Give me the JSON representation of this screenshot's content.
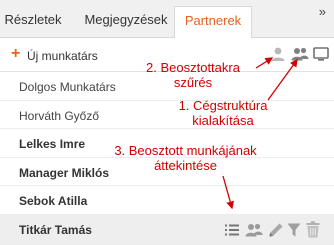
{
  "tabs": [
    {
      "label": "Részletek"
    },
    {
      "label": "Megjegyzések"
    },
    {
      "label": "Partnerek"
    }
  ],
  "more_tabs_glyph": "»",
  "toolbar": {
    "new_label": "Új munkatárs",
    "icons": [
      "user-icon",
      "users-icon",
      "monitor-icon"
    ]
  },
  "people": [
    {
      "name": "Dolgos Munkatárs"
    },
    {
      "name": "Horváth Győző"
    },
    {
      "name": "Lelkes Imre"
    },
    {
      "name": "Manager Miklós"
    },
    {
      "name": "Sebok Atilla"
    },
    {
      "name": "Titkár Tamás"
    }
  ],
  "row_icons": [
    "list-icon",
    "users-icon",
    "pencil-icon",
    "filter-icon",
    "trash-icon"
  ],
  "annotations": {
    "a1_line1": "1. Cégstruktúra",
    "a1_line2": "kialakítása",
    "a2_line1": "2. Beosztottakra",
    "a2_line2": "szűrés",
    "a3_line1": "3. Beosztott munkájának",
    "a3_line2": "áttekintése"
  },
  "colors": {
    "accent": "#e8621c",
    "annotation": "#d40000",
    "selected_row": "#eeeeee",
    "icon_gray": "#a0a0a0"
  }
}
